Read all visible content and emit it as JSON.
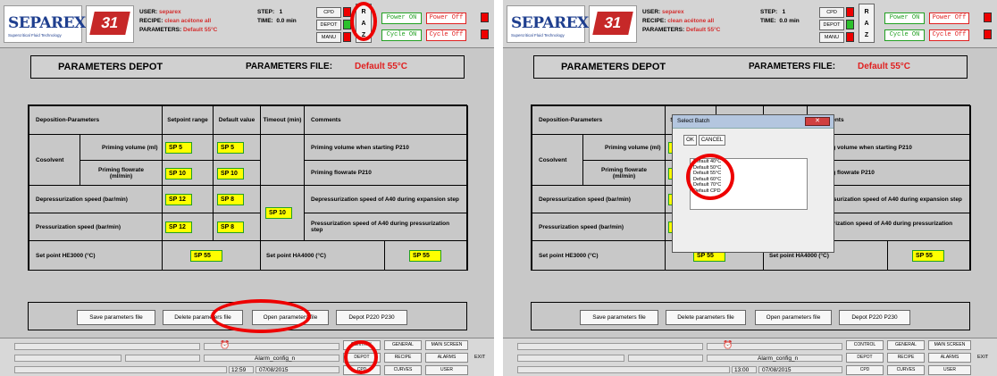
{
  "header": {
    "logo_text": "SEPAREX",
    "logo_tagline": "Supercritical Fluid Technology",
    "logo31_text": "31",
    "user_label": "USER:",
    "user_value": "separex",
    "recipe_label": "RECIPE:",
    "recipe_value": "clean acétone all",
    "parameters_label": "PARAMETERS:",
    "parameters_value": "Default 55°C",
    "step_label": "STEP:",
    "step_value": "1",
    "time_label": "TIME:",
    "time_value": "0.0",
    "time_unit": "min",
    "mode_cpd": "CPD",
    "mode_depot": "DEPOT",
    "mode_manu": "MANU",
    "raz_r": "R",
    "raz_a": "A",
    "raz_z": "Z",
    "power_on": "Power ON",
    "power_off": "Power Off",
    "cycle_on": "Cycle ON",
    "cycle_off": "Cycle Off"
  },
  "title": {
    "main": "PARAMETERS DEPOT",
    "file_label": "PARAMETERS FILE:",
    "file_value": "Default 55°C"
  },
  "table": {
    "headers": {
      "params": "Deposition-Parameters",
      "setpoint": "Setpoint range",
      "default": "Default value",
      "timeout": "Timeout (min)",
      "comments": "Comments"
    },
    "cosolvent": "Cosolvent",
    "rows": {
      "priming_volume": {
        "label": "Priming volume (ml)",
        "sp": "SP 5",
        "def": "SP 5",
        "comment": "Priming volume when starting P210"
      },
      "priming_flowrate": {
        "label": "Priming flowrate (ml/min)",
        "sp": "SP 10",
        "def": "SP 10",
        "comment": "Priming flowrate P210"
      },
      "depress": {
        "label": "Depressurization speed (bar/min)",
        "sp": "SP 12",
        "def": "SP 8",
        "comment": "Depressurization speed of A40 during expansion step"
      },
      "press": {
        "label": "Pressurization speed (bar/min)",
        "sp": "SP 12",
        "def": "SP 8",
        "comment": "Pressurization speed of A40 during pressurization step"
      }
    },
    "timeout_sp": "SP 10",
    "he3000": {
      "label": "Set point HE3000 (°C)",
      "sp": "SP 55"
    },
    "ha4000": {
      "label": "Set point HA4000 (°C)",
      "sp": "SP 55"
    }
  },
  "buttons": {
    "save": "Save parameters file",
    "delete": "Delete parameters file",
    "open": "Open parameters file",
    "depot": "Depot P220 P230"
  },
  "status": {
    "alarm_config": "Alarm_config_n",
    "time_left": "12:59",
    "date_left": "07/08/2015",
    "time_right": "13:00",
    "date_right": "07/08/2015",
    "exit": "EXIT"
  },
  "nav": {
    "control": "CONTROL",
    "general": "GENERAL",
    "main_screen": "MAIN SCREEN",
    "depot": "DEPOT",
    "recipe": "RECIPE",
    "alarms": "ALARMS",
    "cpd": "CPD",
    "curves": "CURVES",
    "user": "USER"
  },
  "dialog": {
    "title": "Select Batch",
    "ok": "OK",
    "cancel": "CANCEL",
    "items": [
      "Default 40°C",
      "Default 50°C",
      "Default 55°C",
      "Default 60°C",
      "Default 70°C",
      "Default CPD"
    ]
  }
}
